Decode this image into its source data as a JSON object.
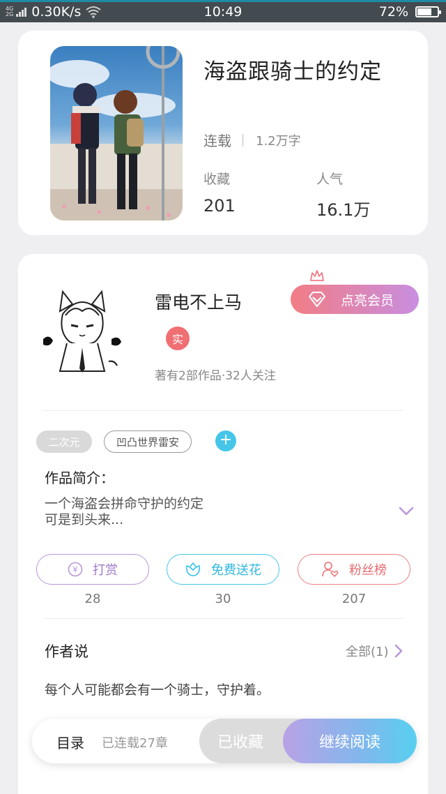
{
  "status_bar": {
    "network_top": "4G",
    "network_bottom": "2G",
    "speed": "0.30K/s",
    "time": "10:49",
    "battery_percent": "72%",
    "battery_level": 0.72
  },
  "book": {
    "title": "海盗跟骑士的约定",
    "status": "连载",
    "word_count": "1.2万字",
    "favorites_label": "收藏",
    "favorites_value": "201",
    "popularity_label": "人气",
    "popularity_value": "16.1万"
  },
  "author": {
    "name": "雷电不上马",
    "verified_badge": "实",
    "meta": "著有2部作品·32人关注",
    "vip_button": "点亮会员"
  },
  "tags": [
    "二次元",
    "凹凸世界雷安"
  ],
  "intro": {
    "title": "作品简介：",
    "text": "一个海盗会拼命守护的约定\n可是到头来..."
  },
  "actions": {
    "reward_label": "打赏",
    "reward_count": "28",
    "flower_label": "免费送花",
    "flower_count": "30",
    "fans_label": "粉丝榜",
    "fans_count": "207"
  },
  "author_says": {
    "title": "作者说",
    "all_label": "全部(1)",
    "text": "每个人可能都会有一个骑士，守护着。"
  },
  "bottom_bar": {
    "catalog": "目录",
    "chapters": "已连载27章",
    "favorited": "已收藏",
    "continue": "继续阅读"
  },
  "colors": {
    "accent_cyan": "#45c6e9",
    "accent_purple": "#b995d9",
    "accent_red": "#ec7f82",
    "status_bar_bg": "#434b50"
  }
}
